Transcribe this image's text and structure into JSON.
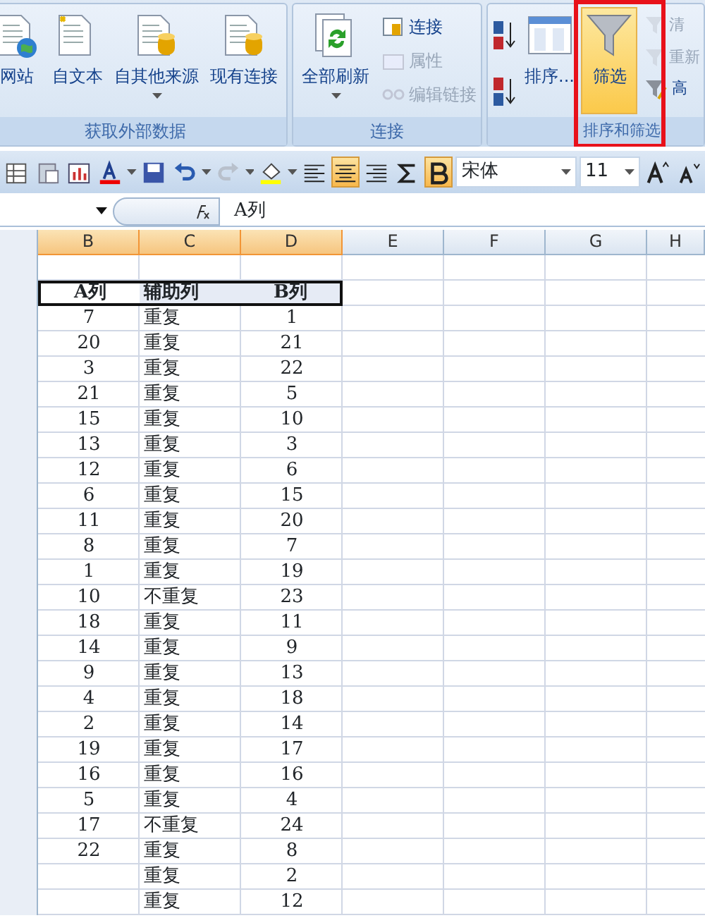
{
  "ribbon": {
    "groups": [
      {
        "label": "获取外部数据",
        "highlighted": false,
        "large": [
          {
            "label": "网站",
            "kind": "web"
          },
          {
            "label": "自文本",
            "kind": "text"
          },
          {
            "label": "自其他来源",
            "kind": "db",
            "dropdown": true
          },
          {
            "label": "现有连接",
            "kind": "conn"
          }
        ]
      },
      {
        "label": "连接",
        "highlighted": false,
        "large": [
          {
            "label": "全部刷新",
            "kind": "refresh",
            "dropdown": true
          }
        ],
        "small": [
          {
            "label": "连接",
            "kind": "conn",
            "disabled": false
          },
          {
            "label": "属性",
            "kind": "props",
            "disabled": true
          },
          {
            "label": "编辑链接",
            "kind": "link",
            "disabled": true
          }
        ]
      },
      {
        "label": "排序和筛选",
        "highlighted": true,
        "sort": [
          {
            "kind": "az"
          },
          {
            "kind": "za"
          }
        ],
        "large": [
          {
            "label": "排序...",
            "kind": "sort",
            "selected": false
          },
          {
            "label": "筛选",
            "kind": "filter",
            "selected": true
          }
        ],
        "small": [
          {
            "label": "清",
            "kind": "clear",
            "disabled": true
          },
          {
            "label": "重新",
            "kind": "reapply",
            "disabled": true
          },
          {
            "label": "高",
            "kind": "advanced",
            "disabled": false
          }
        ]
      }
    ]
  },
  "toolbar": {
    "buttons": [
      {
        "kind": "grid",
        "selected": false
      },
      {
        "kind": "paste",
        "selected": false
      },
      {
        "kind": "chart",
        "selected": false
      },
      {
        "kind": "fontcolor",
        "selected": false,
        "dropdown": true
      },
      {
        "kind": "save",
        "selected": false
      },
      {
        "kind": "undo",
        "selected": false,
        "dropdown": true
      },
      {
        "kind": "redo",
        "selected": false,
        "dropdown": true
      },
      {
        "kind": "fill",
        "selected": false,
        "dropdown": true
      },
      {
        "kind": "left",
        "selected": false
      },
      {
        "kind": "center",
        "selected": true
      },
      {
        "kind": "right",
        "selected": false
      },
      {
        "kind": "sum",
        "selected": false
      },
      {
        "kind": "bold",
        "selected": true
      }
    ],
    "font": "宋体",
    "size": "11"
  },
  "formula_bar": {
    "value": "A列"
  },
  "sheet": {
    "columns": [
      {
        "label": "B",
        "selected": true
      },
      {
        "label": "C",
        "selected": true
      },
      {
        "label": "D",
        "selected": true
      },
      {
        "label": "E",
        "selected": false
      },
      {
        "label": "F",
        "selected": false
      },
      {
        "label": "G",
        "selected": false
      },
      {
        "label": "H",
        "selected": false
      }
    ],
    "header": {
      "cells": [
        "A列",
        "辅助列",
        "B列"
      ],
      "selected": true
    },
    "rows": [
      [
        "7",
        "重复",
        "1"
      ],
      [
        "20",
        "重复",
        "21"
      ],
      [
        "3",
        "重复",
        "22"
      ],
      [
        "21",
        "重复",
        "5"
      ],
      [
        "15",
        "重复",
        "10"
      ],
      [
        "13",
        "重复",
        "3"
      ],
      [
        "12",
        "重复",
        "6"
      ],
      [
        "6",
        "重复",
        "15"
      ],
      [
        "11",
        "重复",
        "20"
      ],
      [
        "8",
        "重复",
        "7"
      ],
      [
        "1",
        "重复",
        "19"
      ],
      [
        "10",
        "不重复",
        "23"
      ],
      [
        "18",
        "重复",
        "11"
      ],
      [
        "14",
        "重复",
        "9"
      ],
      [
        "9",
        "重复",
        "13"
      ],
      [
        "4",
        "重复",
        "18"
      ],
      [
        "2",
        "重复",
        "14"
      ],
      [
        "19",
        "重复",
        "17"
      ],
      [
        "16",
        "重复",
        "16"
      ],
      [
        "5",
        "重复",
        "4"
      ],
      [
        "17",
        "不重复",
        "24"
      ],
      [
        "22",
        "重复",
        "8"
      ],
      [
        null,
        "重复",
        "2"
      ],
      [
        null,
        "重复",
        "12"
      ]
    ]
  }
}
